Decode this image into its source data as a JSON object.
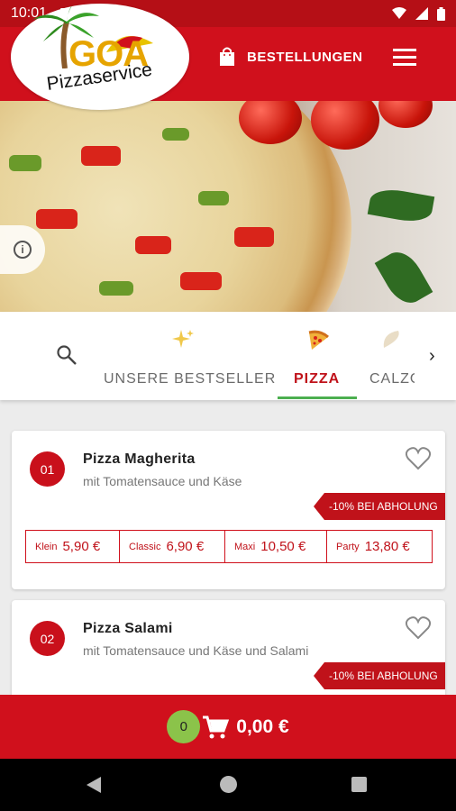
{
  "status_bar": {
    "time": "10:01"
  },
  "header": {
    "logo_text": "GOA",
    "logo_subtitle": "Pizzaservice",
    "orders_label": "BESTELLUNGEN"
  },
  "categories": {
    "items": [
      {
        "label": "UNSERE BESTSELLER",
        "icon": "sparkle-icon",
        "active": false
      },
      {
        "label": "PIZZA",
        "icon": "pizza-slice-icon",
        "active": true
      },
      {
        "label": "CALZO",
        "icon": "calzone-icon",
        "active": false
      }
    ],
    "accent_color": "#4caf50"
  },
  "products": [
    {
      "number": "01",
      "name": "Pizza Magherita",
      "description": "mit Tomatensauce und Käse",
      "promo": "-10% BEI ABHOLUNG",
      "prices": [
        {
          "size": "Klein",
          "price": "5,90 €"
        },
        {
          "size": "Classic",
          "price": "6,90 €"
        },
        {
          "size": "Maxi",
          "price": "10,50 €"
        },
        {
          "size": "Party",
          "price": "13,80 €"
        }
      ]
    },
    {
      "number": "02",
      "name": "Pizza Salami",
      "description": "mit Tomatensauce und Käse und Salami",
      "promo": "-10% BEI ABHOLUNG"
    }
  ],
  "cart": {
    "count": "0",
    "total": "0,00 €"
  },
  "colors": {
    "brand_red": "#d0101c",
    "cart_badge": "#8bc34a"
  }
}
